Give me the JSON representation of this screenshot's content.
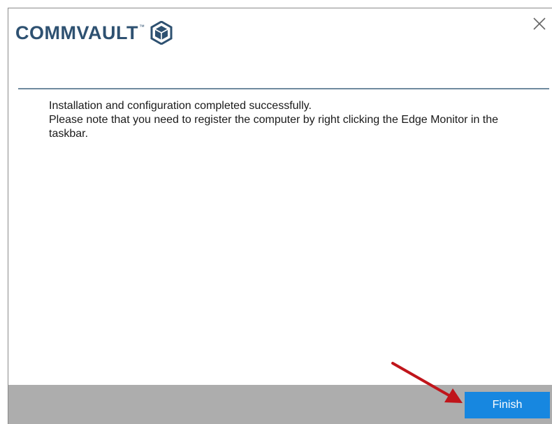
{
  "header": {
    "brand_name": "COMMVAULT",
    "brand_trademark": "™",
    "close_icon": "close-icon",
    "logo_icon": "commvault-cube-icon"
  },
  "message": {
    "line1": "Installation and configuration completed successfully.",
    "line2": "Please note that you need to register the computer by right clicking the Edge Monitor in the taskbar."
  },
  "footer": {
    "finish_label": "Finish"
  },
  "colors": {
    "brand": "#2e5171",
    "accent_button": "#1787e0",
    "footer_bg": "#adadad",
    "annotation_arrow": "#c0151b"
  }
}
